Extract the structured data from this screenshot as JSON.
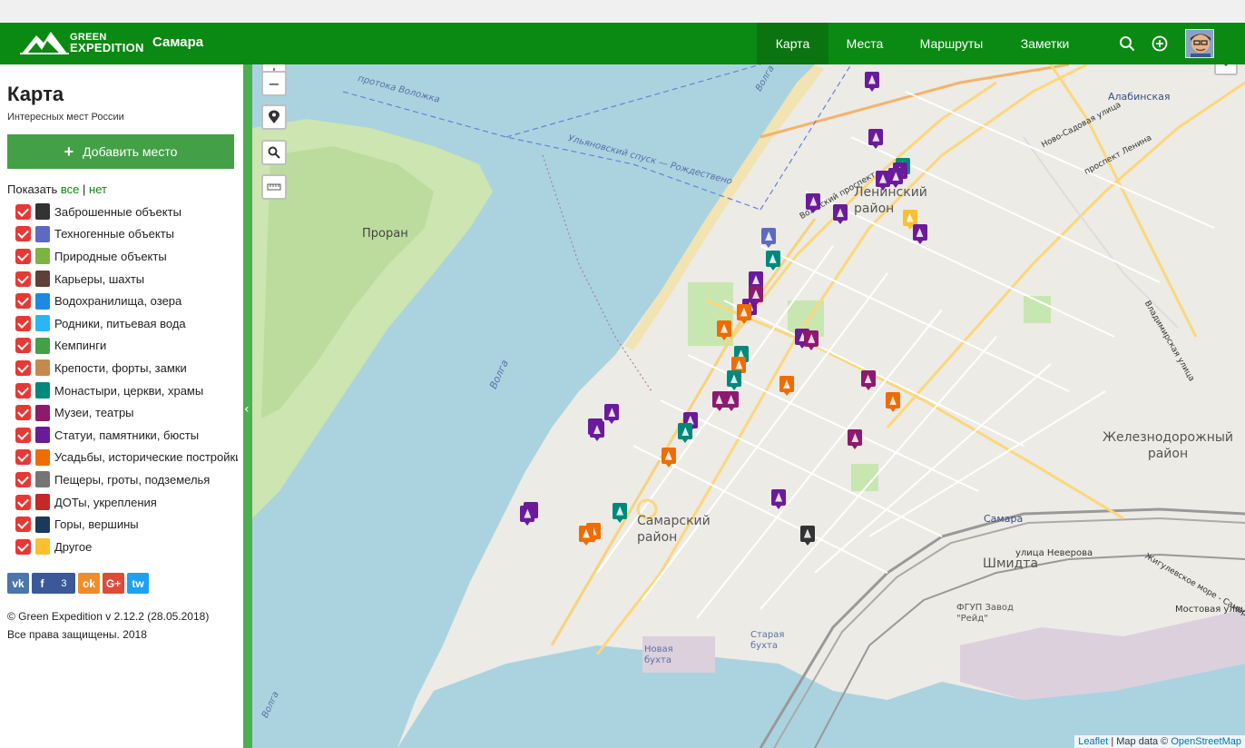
{
  "header": {
    "brand_line1": "GREEN",
    "brand_line2": "EXPEDITION",
    "city": "Самара",
    "nav": [
      {
        "label": "Карта",
        "active": true
      },
      {
        "label": "Места",
        "active": false
      },
      {
        "label": "Маршруты",
        "active": false
      },
      {
        "label": "Заметки",
        "active": false
      }
    ],
    "icons": [
      "search-icon",
      "add-circle-icon",
      "avatar"
    ],
    "color": "#0a8a12"
  },
  "sidebar": {
    "title": "Карта",
    "subtitle": "Интересных мест России",
    "add_button": "Добавить место",
    "show_label": "Показать",
    "show_all": "все",
    "show_sep": "|",
    "show_none": "нет",
    "categories": [
      {
        "label": "Заброшенные объекты",
        "color": "#333333",
        "checked": true
      },
      {
        "label": "Техногенные объекты",
        "color": "#5c6bc0",
        "checked": true
      },
      {
        "label": "Природные объекты",
        "color": "#7cb342",
        "checked": true
      },
      {
        "label": "Карьеры, шахты",
        "color": "#5d4037",
        "checked": true
      },
      {
        "label": "Водохранилища, озера",
        "color": "#1e88e5",
        "checked": true
      },
      {
        "label": "Родники, питьевая вода",
        "color": "#29b6f6",
        "checked": true
      },
      {
        "label": "Кемпинги",
        "color": "#43a047",
        "checked": true
      },
      {
        "label": "Крепости, форты, замки",
        "color": "#c48a4a",
        "checked": true
      },
      {
        "label": "Монастыри, церкви, храмы",
        "color": "#00897b",
        "checked": true
      },
      {
        "label": "Музеи, театры",
        "color": "#8e1a6e",
        "checked": true
      },
      {
        "label": "Статуи, памятники, бюсты",
        "color": "#6a1b9a",
        "checked": true
      },
      {
        "label": "Усадьбы, исторические постройки",
        "color": "#ef6c00",
        "checked": true
      },
      {
        "label": "Пещеры, гроты, подземелья",
        "color": "#757575",
        "checked": true
      },
      {
        "label": "ДОТы, укрепления",
        "color": "#c62828",
        "checked": true
      },
      {
        "label": "Горы, вершины",
        "color": "#1a3a5c",
        "checked": true
      },
      {
        "label": "Другое",
        "color": "#fbc02d",
        "checked": true
      }
    ],
    "social": [
      {
        "label": "vk",
        "color": "#4a76a8"
      },
      {
        "label": "f",
        "count": "3",
        "color": "#3b5998"
      },
      {
        "label": "ok",
        "color": "#f08c2a"
      },
      {
        "label": "G+",
        "color": "#dd4b39"
      },
      {
        "label": "tw",
        "color": "#1da1f2"
      }
    ],
    "copyright": "© Green Expedition v 2.12.2 (28.05.2018)",
    "rights": "Все права защищены. 2018"
  },
  "map": {
    "attribution_leaflet": "Leaflet",
    "attribution_sep": " | Map data © ",
    "attribution_osm": "OpenStreetMap",
    "labels": {
      "proran": "Проран",
      "protoka": "протока Воложка",
      "volga1": "Волга",
      "volga2": "Волга",
      "volga3": "Волга",
      "spusk": "Ульяновский спуск — Рождествено",
      "leninsky": "Ленинский район",
      "samarsky": "Самарский район",
      "zhd": "Железнодорожный район",
      "shmidta": "Шмидта",
      "alabinskaya": "Алабинская",
      "samara_st": "Самара",
      "novaya": "Новая бухта",
      "staraya": "Старая бухта",
      "fgup": "ФГУП Завод \"Рейд\"",
      "nevrova": "улица Неверова",
      "mostovaya": "Мостовая улица",
      "volzhsky": "Волжский проспект",
      "lenina": "проспект Ленина",
      "novosad": "Ново-Садовая улица",
      "vladimir": "Владимирская улица",
      "zhigul": "Жигулевское море - Самара"
    },
    "markers": [
      {
        "x": 0.617,
        "y": 0.01,
        "c": "#6a1b9a"
      },
      {
        "x": 0.621,
        "y": 0.094,
        "c": "#6a1b9a"
      },
      {
        "x": 0.648,
        "y": 0.137,
        "c": "#00897b"
      },
      {
        "x": 0.645,
        "y": 0.144,
        "c": "#6a1b9a"
      },
      {
        "x": 0.641,
        "y": 0.152,
        "c": "#6a1b9a"
      },
      {
        "x": 0.628,
        "y": 0.155,
        "c": "#6a1b9a"
      },
      {
        "x": 0.558,
        "y": 0.188,
        "c": "#6a1b9a"
      },
      {
        "x": 0.585,
        "y": 0.205,
        "c": "#6a1b9a"
      },
      {
        "x": 0.655,
        "y": 0.212,
        "c": "#fbc02d"
      },
      {
        "x": 0.665,
        "y": 0.234,
        "c": "#6a1b9a"
      },
      {
        "x": 0.513,
        "y": 0.239,
        "c": "#5c6bc0"
      },
      {
        "x": 0.517,
        "y": 0.272,
        "c": "#00897b"
      },
      {
        "x": 0.5,
        "y": 0.303,
        "c": "#6a1b9a"
      },
      {
        "x": 0.5,
        "y": 0.324,
        "c": "#8e1a6e"
      },
      {
        "x": 0.494,
        "y": 0.342,
        "c": "#6a1b9a"
      },
      {
        "x": 0.488,
        "y": 0.35,
        "c": "#ef6c00"
      },
      {
        "x": 0.468,
        "y": 0.374,
        "c": "#ef6c00"
      },
      {
        "x": 0.547,
        "y": 0.387,
        "c": "#6a1b9a"
      },
      {
        "x": 0.556,
        "y": 0.389,
        "c": "#8e1a6e"
      },
      {
        "x": 0.485,
        "y": 0.412,
        "c": "#00897b"
      },
      {
        "x": 0.483,
        "y": 0.427,
        "c": "#ef6c00"
      },
      {
        "x": 0.478,
        "y": 0.448,
        "c": "#00897b"
      },
      {
        "x": 0.531,
        "y": 0.456,
        "c": "#ef6c00"
      },
      {
        "x": 0.613,
        "y": 0.448,
        "c": "#8e1a6e"
      },
      {
        "x": 0.463,
        "y": 0.478,
        "c": "#8e1a6e"
      },
      {
        "x": 0.475,
        "y": 0.478,
        "c": "#8e1a6e"
      },
      {
        "x": 0.638,
        "y": 0.48,
        "c": "#ef6c00"
      },
      {
        "x": 0.355,
        "y": 0.497,
        "c": "#6a1b9a"
      },
      {
        "x": 0.434,
        "y": 0.508,
        "c": "#6a1b9a"
      },
      {
        "x": 0.338,
        "y": 0.518,
        "c": "#6a1b9a"
      },
      {
        "x": 0.34,
        "y": 0.522,
        "c": "#6a1b9a"
      },
      {
        "x": 0.429,
        "y": 0.525,
        "c": "#00897b"
      },
      {
        "x": 0.6,
        "y": 0.534,
        "c": "#8e1a6e"
      },
      {
        "x": 0.412,
        "y": 0.56,
        "c": "#ef6c00"
      },
      {
        "x": 0.523,
        "y": 0.621,
        "c": "#6a1b9a"
      },
      {
        "x": 0.273,
        "y": 0.64,
        "c": "#6a1b9a"
      },
      {
        "x": 0.27,
        "y": 0.645,
        "c": "#6a1b9a"
      },
      {
        "x": 0.363,
        "y": 0.641,
        "c": "#00897b"
      },
      {
        "x": 0.336,
        "y": 0.67,
        "c": "#ef6c00"
      },
      {
        "x": 0.329,
        "y": 0.674,
        "c": "#ef6c00"
      },
      {
        "x": 0.552,
        "y": 0.674,
        "c": "#333333"
      }
    ]
  }
}
